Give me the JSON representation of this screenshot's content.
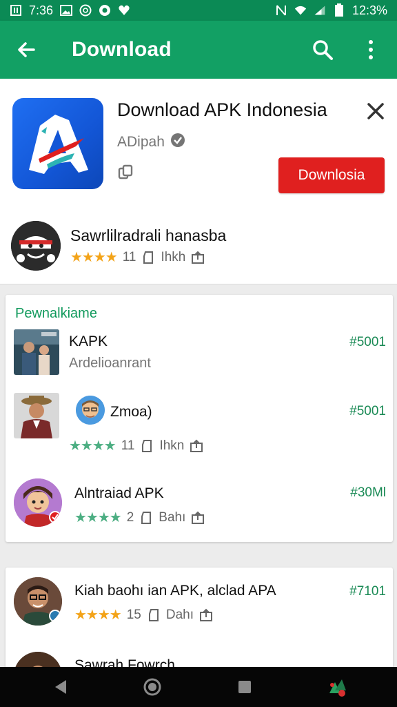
{
  "status_bar": {
    "time": "7:36",
    "battery": "12:3%",
    "left_icons": [
      "sim-icon",
      "image-icon",
      "camera-icon",
      "record-icon",
      "heart-icon"
    ],
    "right_icons": [
      "nfc-icon",
      "wifi-icon",
      "signal-icon",
      "battery-icon"
    ]
  },
  "app_bar": {
    "title": "Download",
    "icons": [
      "back-arrow-icon",
      "search-icon",
      "more-vert-icon"
    ]
  },
  "header": {
    "app_title": "Download APK Indonesia",
    "developer": "ADipah",
    "download_label": "Downlosia",
    "sub_app": {
      "title": "Sawrlilradrali hanasba",
      "rating_count": "11",
      "meta": "Ihkh"
    }
  },
  "section": {
    "title": "Pewnalkiame",
    "items": [
      {
        "name": "KAPK",
        "subtext": "Ardelioanrant",
        "price": "#5001"
      },
      {
        "name": "Zmoa)",
        "rating_count": "11",
        "meta": "Ihkn",
        "price": "#5001"
      },
      {
        "name": "Alntraiad APK",
        "rating_count": "2",
        "meta": "Bahı",
        "price": "#30Ml"
      }
    ]
  },
  "bottom": {
    "item1": {
      "name": "Kiah baohı ian APK, alclad APA",
      "rating_count": "15",
      "meta": "Dahı",
      "price": "#7101"
    },
    "item2": {
      "name": "Sawrah Fowrch"
    }
  },
  "colors": {
    "status_bar": "#0b8a55",
    "app_bar": "#12a064",
    "download_button": "#e0201f",
    "accent_green": "#129a5d",
    "star_orange": "#f3a318",
    "star_green": "#4cae82"
  }
}
